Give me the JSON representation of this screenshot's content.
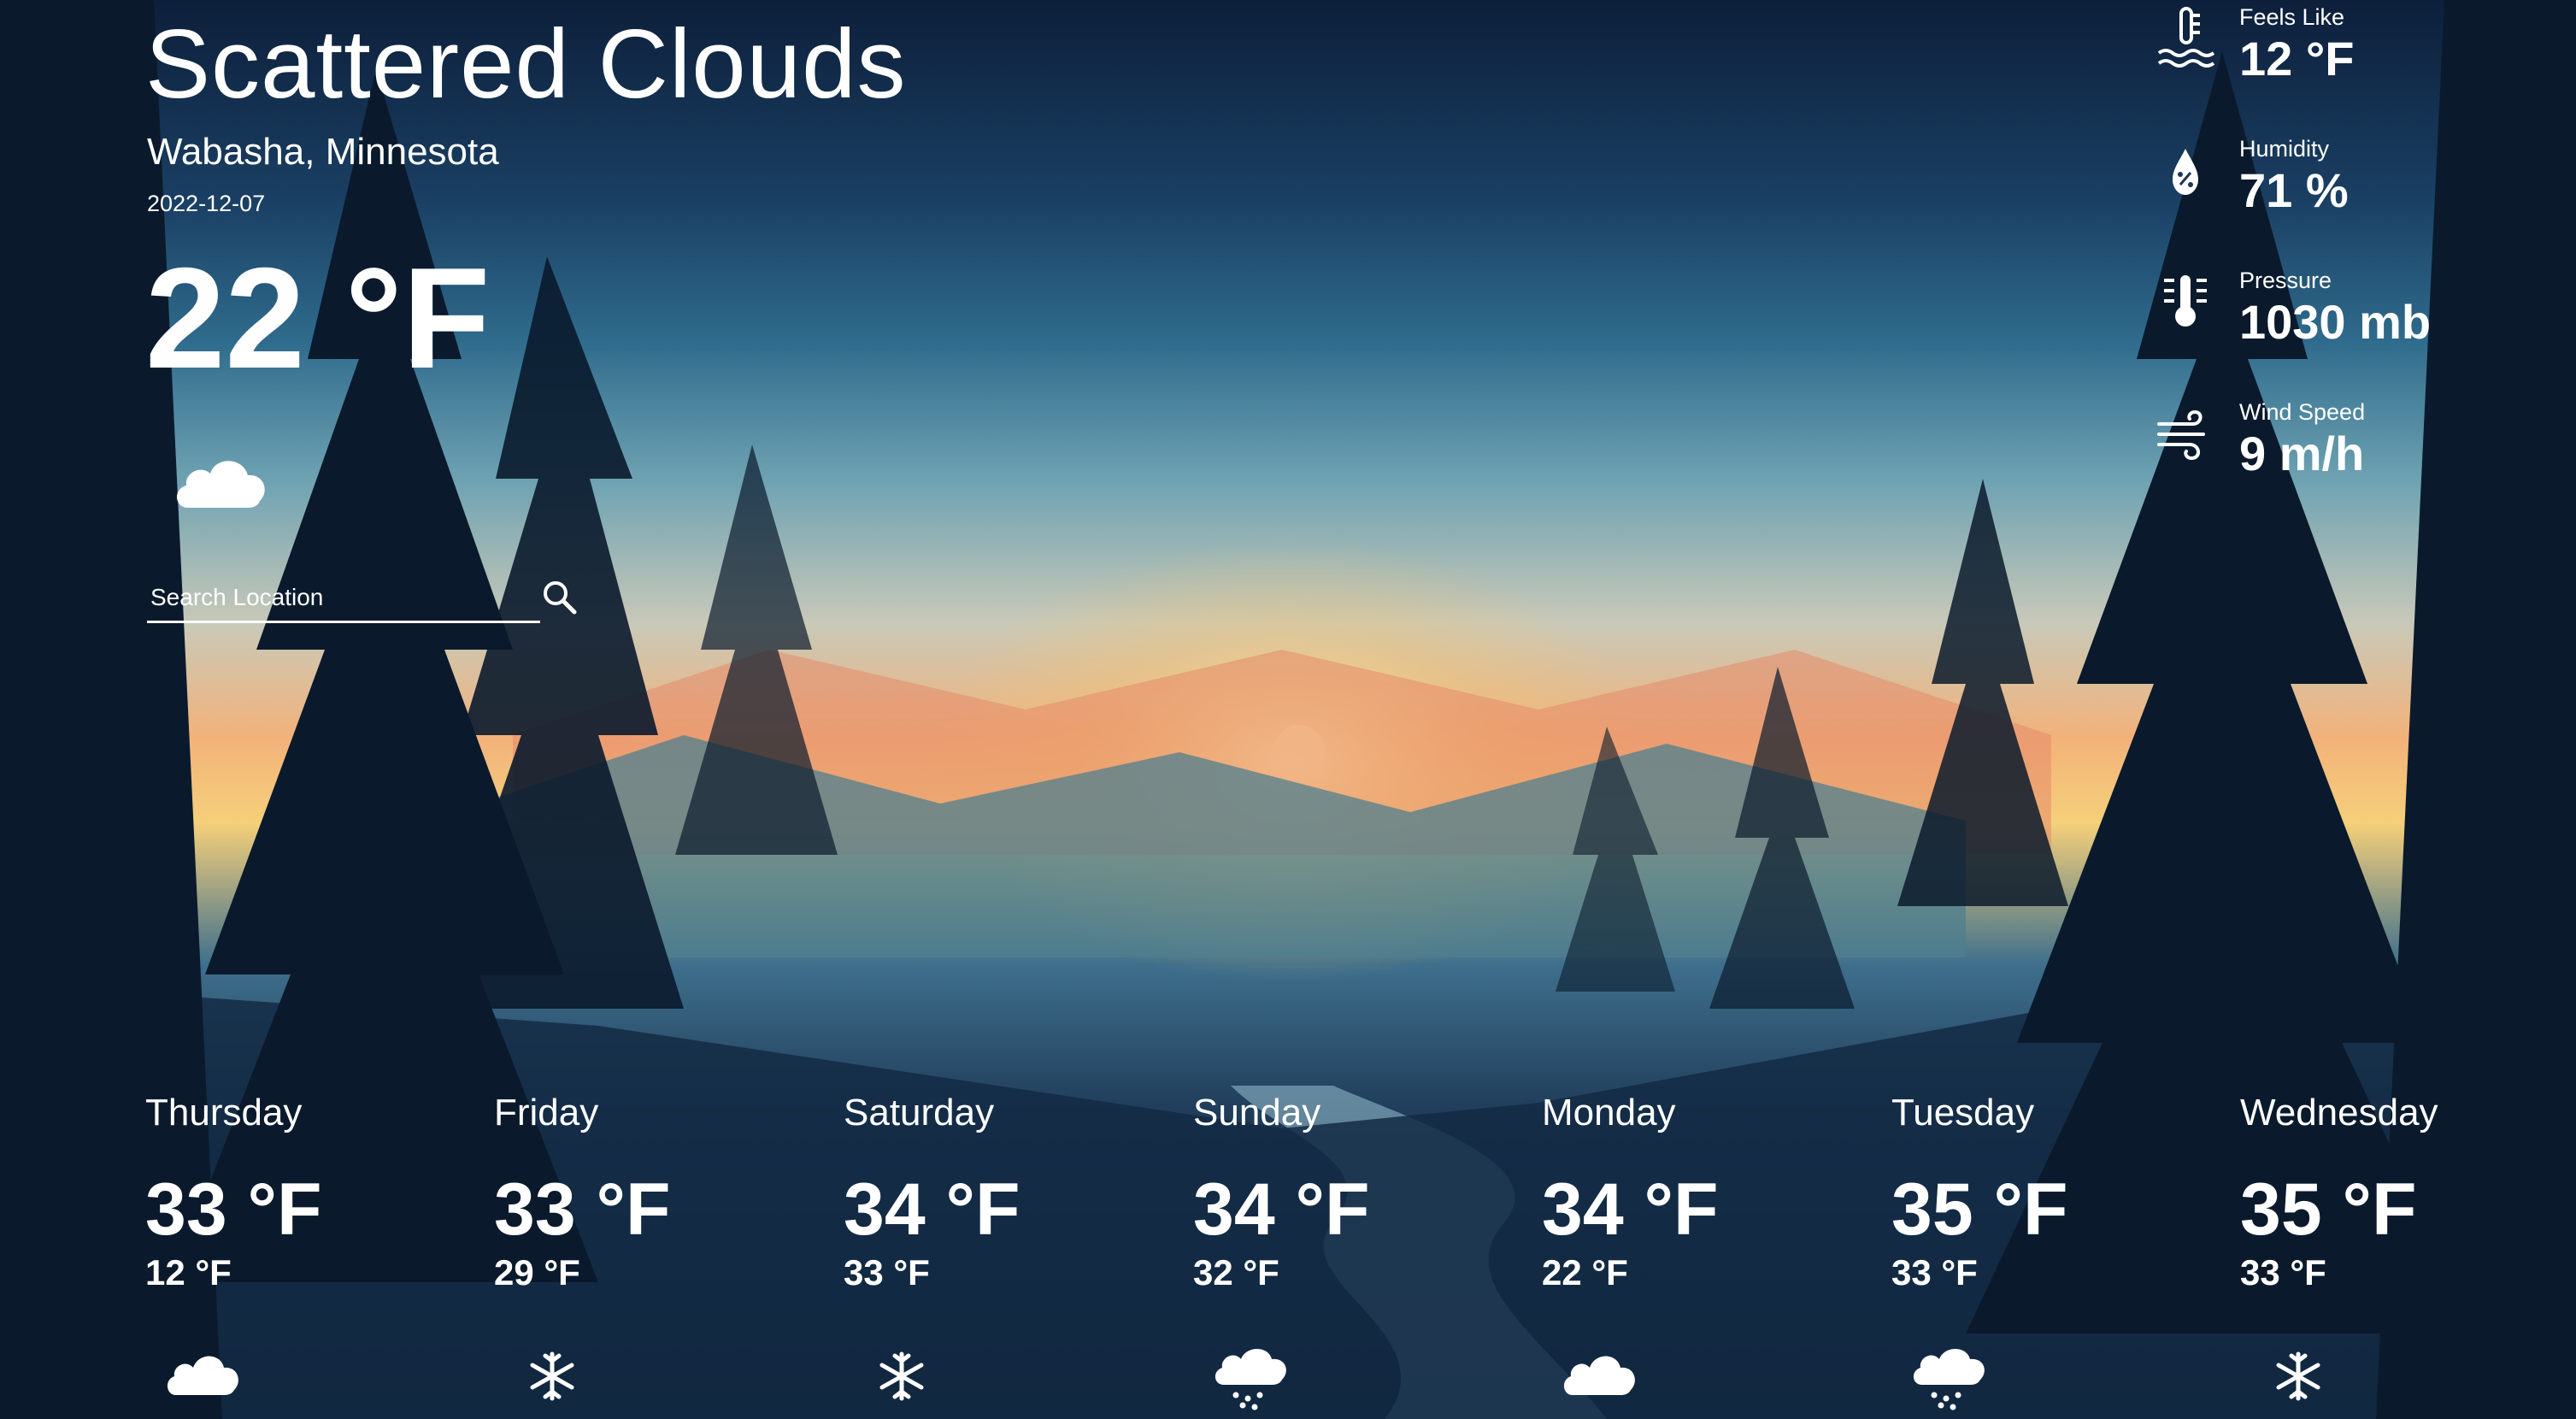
{
  "current": {
    "condition": "Scattered Clouds",
    "location": "Wabasha, Minnesota",
    "date": "2022-12-07",
    "temperature": "22 °F",
    "icon": "cloud-icon"
  },
  "search": {
    "placeholder": "Search Location",
    "icon": "search-icon"
  },
  "stats": [
    {
      "label": "Feels Like",
      "value": "12 °F",
      "icon": "thermometer-water-icon"
    },
    {
      "label": "Humidity",
      "value": "71 %",
      "icon": "humidity-drop-icon"
    },
    {
      "label": "Pressure",
      "value": "1030 mb",
      "icon": "pressure-thermometer-icon"
    },
    {
      "label": "Wind Speed",
      "value": "9 m/h",
      "icon": "wind-icon"
    }
  ],
  "forecast": [
    {
      "day": "Thursday",
      "high": "33 °F",
      "low": "12 °F",
      "icon": "cloud-icon"
    },
    {
      "day": "Friday",
      "high": "33 °F",
      "low": "29 °F",
      "icon": "snowflake-icon"
    },
    {
      "day": "Saturday",
      "high": "34 °F",
      "low": "33 °F",
      "icon": "snowflake-icon"
    },
    {
      "day": "Sunday",
      "high": "34 °F",
      "low": "32 °F",
      "icon": "cloud-snow-icon"
    },
    {
      "day": "Monday",
      "high": "34 °F",
      "low": "22 °F",
      "icon": "cloud-icon"
    },
    {
      "day": "Tuesday",
      "high": "35 °F",
      "low": "33 °F",
      "icon": "cloud-snow-icon"
    },
    {
      "day": "Wednesday",
      "high": "35 °F",
      "low": "33 °F",
      "icon": "snowflake-icon"
    }
  ],
  "colors": {
    "text": "#ffffff",
    "sky_top": "#0d1f3a",
    "sunset": "#f2b27a",
    "forest": "#0c1a2e"
  }
}
